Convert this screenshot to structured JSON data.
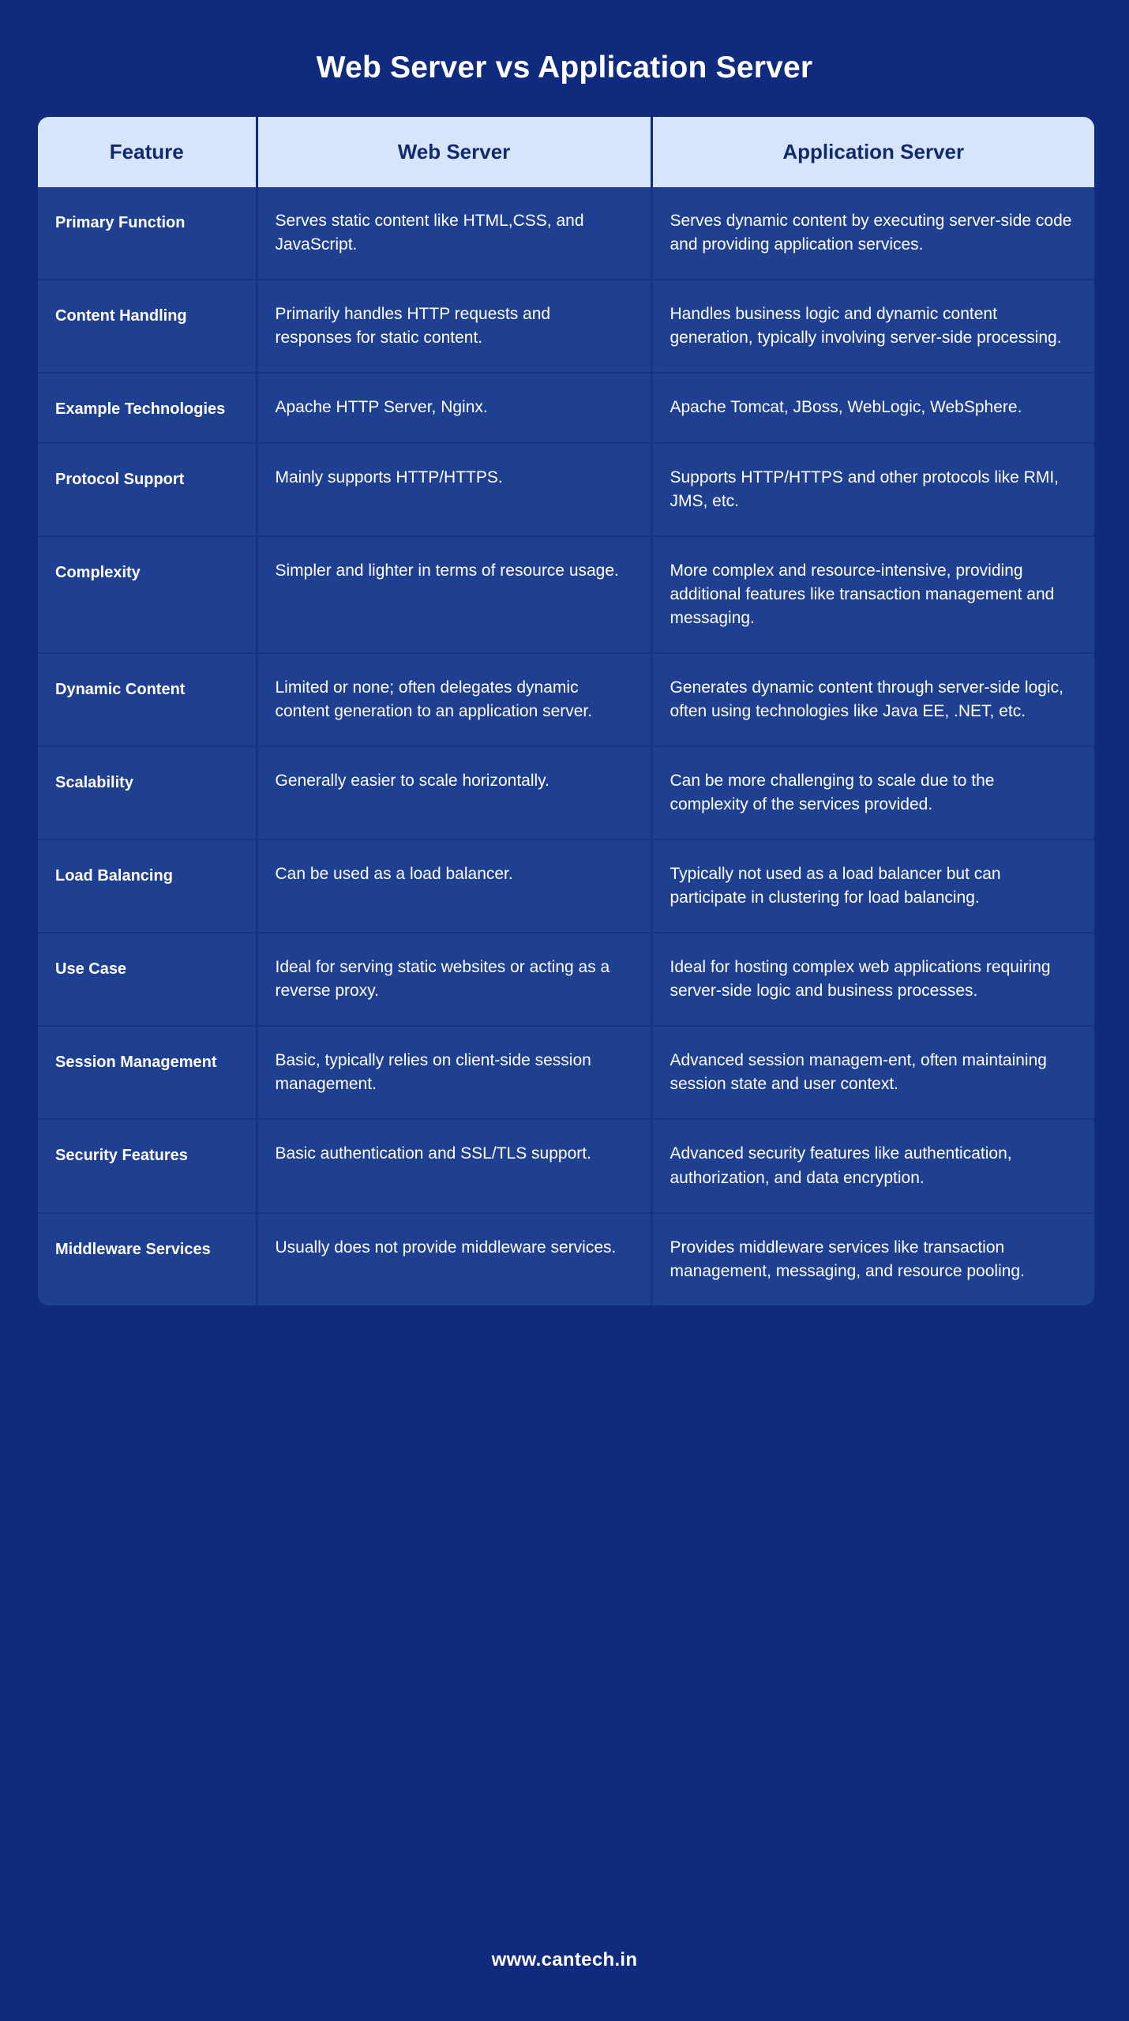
{
  "title": "Web Server vs Application Server",
  "footer": {
    "url": "www.cantech.in"
  },
  "colors": {
    "background": "#102a7d",
    "header_bg": "#d7e5fb",
    "header_text": "#0f2a6e",
    "cell_bg": "#1f3f91",
    "cell_text": "#ffffff",
    "divider": "#16347f"
  },
  "table": {
    "headers": [
      "Feature",
      "Web Server",
      "Application Server"
    ],
    "rows": [
      {
        "feature": "Primary Function",
        "web_server": "Serves static content like HTML,CSS, and JavaScript.",
        "application_server": "Serves dynamic content by executing server-side code and providing application services."
      },
      {
        "feature": "Content Handling",
        "web_server": "Primarily handles HTTP requests and responses for static content.",
        "application_server": "Handles business logic and dynamic content generation, typically involving server-side processing."
      },
      {
        "feature": "Example Technologies",
        "web_server": "Apache HTTP Server, Nginx.",
        "application_server": "Apache Tomcat, JBoss, WebLogic, WebSphere."
      },
      {
        "feature": "Protocol Support",
        "web_server": "Mainly supports HTTP/HTTPS.",
        "application_server": "Supports HTTP/HTTPS and other protocols like RMI, JMS, etc."
      },
      {
        "feature": "Complexity",
        "web_server": "Simpler and lighter in terms of resource usage.",
        "application_server": "More complex and resource-intensive, providing additional features like transaction management and messaging."
      },
      {
        "feature": "Dynamic Content",
        "web_server": "Limited or none; often delegates dynamic content generation to an application server.",
        "application_server": "Generates dynamic content through server-side logic, often using technologies like Java EE, .NET, etc."
      },
      {
        "feature": "Scalability",
        "web_server": "Generally easier to scale horizontally.",
        "application_server": "Can be more challenging to scale due to the complexity of the services provided."
      },
      {
        "feature": "Load Balancing",
        "web_server": "Can be used as a load balancer.",
        "application_server": "Typically not used as a load balancer but can participate in clustering for load balancing."
      },
      {
        "feature": "Use Case",
        "web_server": "Ideal for serving static websites or acting as a reverse proxy.",
        "application_server": "Ideal for hosting complex web applications requiring server-side logic and business processes."
      },
      {
        "feature": "Session Management",
        "web_server": "Basic, typically relies on client-side session management.",
        "application_server": "Advanced session managem-ent, often maintaining session state and user context."
      },
      {
        "feature": "Security Features",
        "web_server": "Basic authentication and SSL/TLS support.",
        "application_server": "Advanced security features like authentication, authorization, and data encryption."
      },
      {
        "feature": "Middleware Services",
        "web_server": "Usually does not provide middleware services.",
        "application_server": "Provides middleware services like transaction management, messaging, and resource pooling."
      }
    ]
  }
}
